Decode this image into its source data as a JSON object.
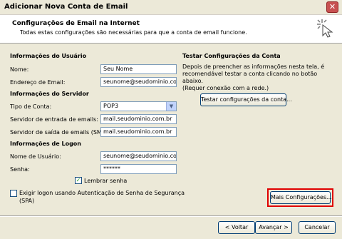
{
  "window": {
    "title": "Adicionar Nova Conta de Email",
    "close_glyph": "✕"
  },
  "header": {
    "title": "Configurações de Email na Internet",
    "subtitle": "Todas estas configurações são necessárias para que a conta de email funcione."
  },
  "user_info": {
    "heading": "Informações do Usuário",
    "name_label": "Nome:",
    "name_value": "Seu Nome",
    "email_label": "Endereço de Email:",
    "email_value": "seunome@seudominio.com.br"
  },
  "server_info": {
    "heading": "Informações do Servidor",
    "account_type_label": "Tipo de Conta:",
    "account_type_value": "POP3",
    "incoming_label": "Servidor de entrada de emails:",
    "incoming_value": "mail.seudominio.com.br",
    "outgoing_label": "Servidor de saída de emails (SMTP):",
    "outgoing_value": "mail.seudominio.com.br"
  },
  "logon_info": {
    "heading": "Informações de Logon",
    "username_label": "Nome de Usuário:",
    "username_value": "seunome@seudominio.com.br",
    "password_label": "Senha:",
    "password_value": "******",
    "remember_label": "Lembrar senha",
    "remember_checked": true,
    "spa_label_line1": "Exigir logon usando Autenticação de Senha de Segurança",
    "spa_label_line2": "(SPA)",
    "spa_checked": false
  },
  "test_settings": {
    "heading": "Testar Configurações da Conta",
    "line1": "Depois de preencher as informações nesta tela, é",
    "line2": "recomendável testar a conta clicando no botão abaixo.",
    "line3": "(Requer conexão com a rede.)",
    "test_button": "Testar configurações da conta..."
  },
  "more_settings_button": "Mais Configurações...",
  "footer": {
    "back_button": "< Voltar",
    "next_button": "Avançar >",
    "cancel_button": "Cancelar"
  },
  "colors": {
    "highlight": "#e00000",
    "dialog_bg": "#ece9d8",
    "field_border": "#7f9db9"
  },
  "icons": {
    "close": "close-icon",
    "wizard": "wizard-cursor-icon",
    "dropdown": "chevron-down-icon",
    "check": "checkmark-icon"
  }
}
